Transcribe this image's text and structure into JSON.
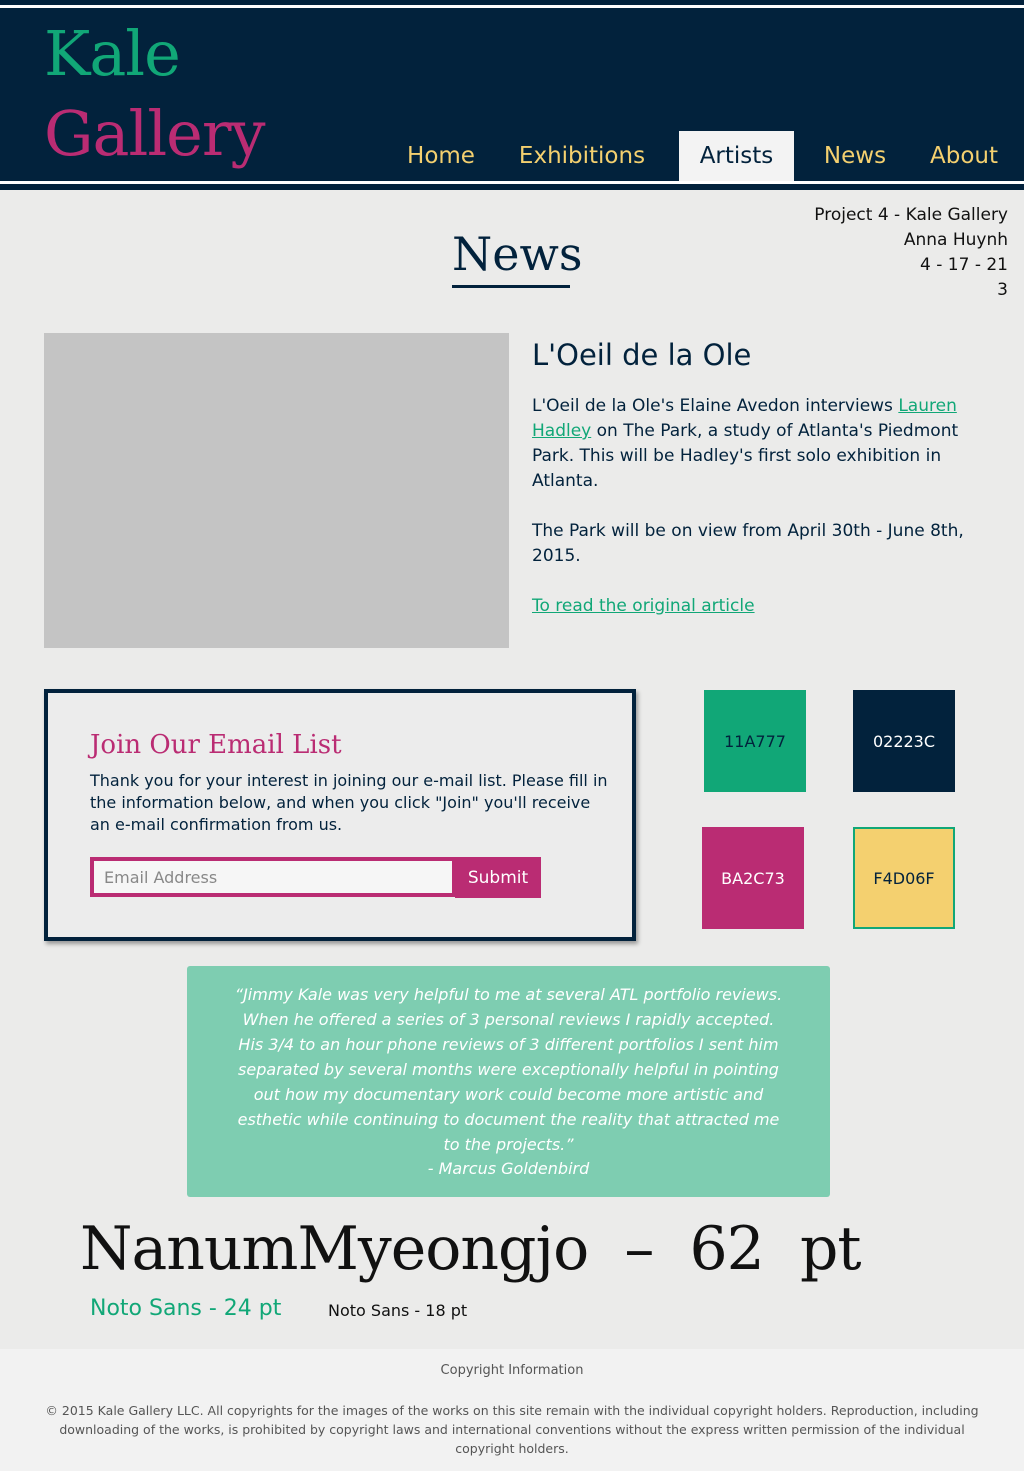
{
  "header": {
    "logo_line1": "Kale",
    "logo_line2": "Gallery",
    "nav": [
      "Home",
      "Exhibitions",
      "Artists",
      "News",
      "About"
    ],
    "active_nav": "Artists"
  },
  "meta": {
    "project": "Project 4 - Kale Gallery",
    "author": "Anna Huynh",
    "date": "4 - 17 - 21",
    "number": "3"
  },
  "page_title": "News",
  "article": {
    "title": "L'Oeil de la Ole",
    "intro_before_link": "L'Oeil de la Ole's Elaine Avedon interviews ",
    "artist_link": "Lauren Hadley",
    "intro_after_link": " on The Park, a study of Atlanta's Piedmont Park. This will be Hadley's first solo exhibition in Atlanta.",
    "view_dates": "The Park will be on view from April 30th - June 8th, 2015.",
    "read_link": "To read the original article"
  },
  "email_signup": {
    "title": "Join Our Email List",
    "description": "Thank you for your interest in joining our e-mail list. Please fill in the information below, and when you click \"Join\" you'll receive an e-mail confirmation from us.",
    "placeholder": "Email Address",
    "submit_label": "Submit"
  },
  "swatches": [
    {
      "label": "11A777",
      "color": "#11a777",
      "text_color": "#02223c",
      "border": "none"
    },
    {
      "label": "02223C",
      "color": "#02223c",
      "text_color": "#ffffff",
      "border": "none"
    },
    {
      "label": "BA2C73",
      "color": "#ba2c73",
      "text_color": "#ffffff",
      "border": "none"
    },
    {
      "label": "F4D06F",
      "color": "#f4d06f",
      "text_color": "#02223c",
      "border": "#11a777"
    }
  ],
  "testimonial": {
    "quote": "“Jimmy Kale was very helpful to me at several ATL portfolio reviews. When he offered a series of 3 personal reviews I rapidly accepted. His 3/4 to an hour phone reviews of 3 different portfolios I sent him separated by several months were exceptionally helpful in pointing out how my documentary work could become more artistic and esthetic while continuing to document the reality that attracted me to the projects.”",
    "author": "- Marcus Goldenbird"
  },
  "type_samples": {
    "large": "NanumMyeongjo  –  62  pt",
    "medium": "Noto Sans - 24 pt",
    "small": "Noto Sans - 18 pt"
  },
  "footer": {
    "title": "Copyright Information",
    "text": "© 2015 Kale Gallery LLC. All copyrights for the images of the works on this site remain with the individual copyright holders. Reproduction, including downloading of the works, is prohibited by copyright laws and international conventions without the express written permission of the individual copyright holders."
  },
  "colors": {
    "green": "#11a777",
    "navy": "#02223c",
    "magenta": "#ba2c73",
    "yellow": "#f4d06f"
  }
}
